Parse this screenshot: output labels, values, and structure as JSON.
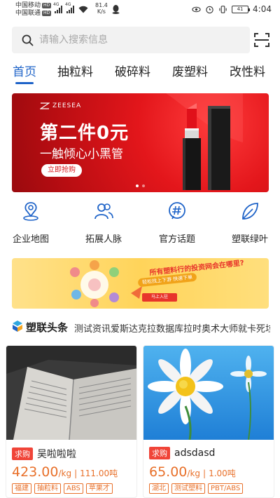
{
  "status_bar": {
    "carrier1": "中国移动",
    "carrier2": "中国联通",
    "hd": "HD",
    "net1": "4G",
    "net2": "4G",
    "speed_value": "81.4",
    "speed_unit": "K/s",
    "battery": "41",
    "time": "4:04"
  },
  "search": {
    "placeholder": "请输入搜索信息",
    "icon": "search-icon",
    "scan_icon": "scan-icon"
  },
  "tabs": [
    "首页",
    "抽粒料",
    "破碎料",
    "废塑料",
    "改性料"
  ],
  "active_tab_index": 0,
  "banner": {
    "brand": "ZEESEA",
    "title": "第二件0元",
    "subtitle": "一触倾心小黑管",
    "button": "立即抢购",
    "slide_count": 2,
    "active_slide": 0,
    "colors": {
      "background": "#e3161b",
      "button_text": "#d9161b"
    }
  },
  "quick_links": [
    {
      "label": "企业地图",
      "icon": "map-pin-icon"
    },
    {
      "label": "拓展人脉",
      "icon": "contacts-icon"
    },
    {
      "label": "官方话题",
      "icon": "hashtag-icon"
    },
    {
      "label": "塑联绿叶",
      "icon": "leaf-icon"
    }
  ],
  "promo": {
    "title": "所有塑料行的投资网会在哪里?",
    "subtitle": "轻松找上下游   快速下单",
    "button": "马上入驻"
  },
  "news": {
    "title": "塑联头条",
    "text": "测试资讯爱斯达克拉数据库拉时奥术大师就卡死垃圾"
  },
  "products": [
    {
      "tag": "求购",
      "name": "吴啦啦啦",
      "price": "423.00",
      "unit": "/kg",
      "quantity": "111.00吨",
      "tags": [
        "福建",
        "抽粒料",
        "ABS",
        "苹果才"
      ]
    },
    {
      "tag": "求购",
      "name": "adsdasd",
      "price": "65.00",
      "unit": "/kg",
      "quantity": "1.00吨",
      "tags": [
        "湖北",
        "测试塑料",
        "PBT/ABS"
      ]
    }
  ],
  "colors": {
    "accent": "#1e63c8",
    "price": "#e8702a",
    "buy_tag": "#f04438"
  }
}
